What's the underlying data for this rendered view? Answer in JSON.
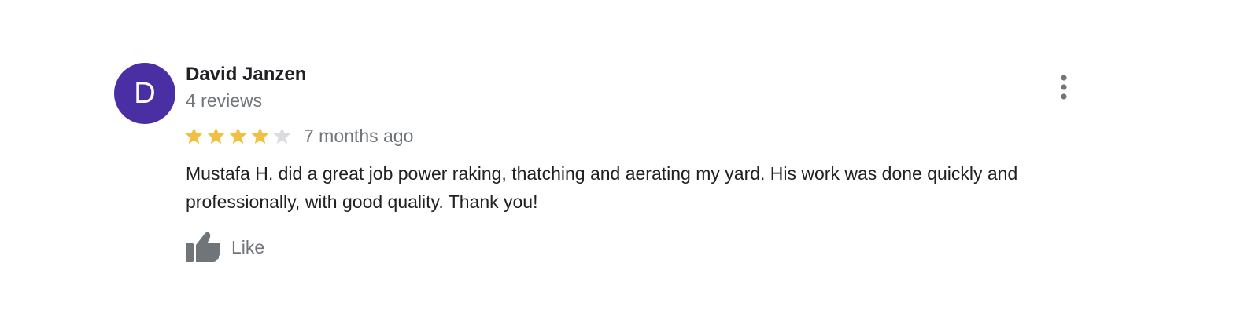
{
  "review": {
    "author": {
      "initial": "D",
      "name": "David Janzen",
      "review_count": "4 reviews",
      "avatar_color": "#4a2ea4"
    },
    "rating": {
      "value": 4,
      "max": 5,
      "filled_color": "#f1bf42",
      "empty_color": "#dadce0"
    },
    "time": "7 months ago",
    "text": "Mustafa H. did a great job power raking, thatching and aerating my yard. His work was done quickly and professionally, with good quality. Thank you!",
    "like": {
      "label": "Like",
      "icon": "thumbs-up-icon"
    },
    "more": {
      "icon": "more-vert-icon"
    }
  }
}
